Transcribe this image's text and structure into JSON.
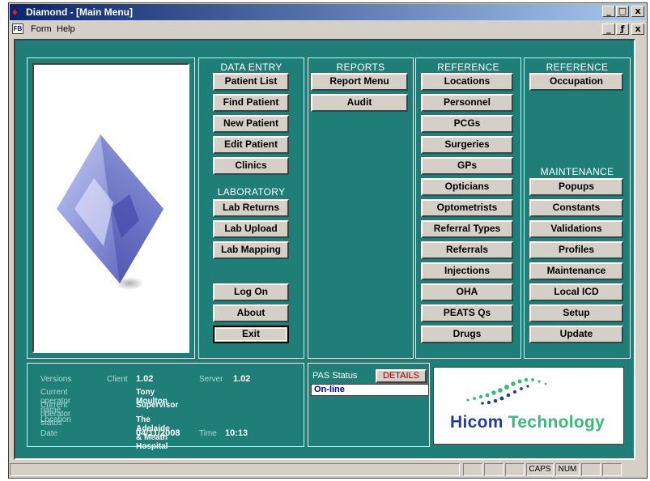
{
  "window": {
    "title": "Diamond - [Main Menu]",
    "controls": [
      "_",
      "□",
      "x"
    ],
    "mdi_controls": [
      "_",
      "ƒ",
      "x"
    ]
  },
  "menubar": {
    "items": [
      "Form",
      "Help"
    ]
  },
  "data_entry": {
    "title": "DATA ENTRY",
    "buttons": [
      "Patient  List",
      "Find Patient",
      "New Patient",
      "Edit Patient",
      "Clinics"
    ]
  },
  "laboratory": {
    "title": "LABORATORY",
    "buttons": [
      "Lab Returns",
      "Lab Upload",
      "Lab Mapping"
    ]
  },
  "session": {
    "buttons": [
      "Log On",
      "About",
      "Exit"
    ]
  },
  "reports": {
    "title": "REPORTS",
    "buttons": [
      "Report Menu",
      "Audit"
    ]
  },
  "reference1": {
    "title": "REFERENCE",
    "buttons": [
      "Locations",
      "Personnel",
      "PCGs",
      "Surgeries",
      "GPs",
      "Opticians",
      "Optometrists",
      "Referral Types",
      "Referrals",
      "Injections",
      "OHA",
      "PEATS Qs",
      "Drugs"
    ]
  },
  "reference2": {
    "title": "REFERENCE",
    "buttons": [
      "Occupation"
    ]
  },
  "maintenance": {
    "title": "MAINTENANCE",
    "buttons": [
      "Popups",
      "Constants",
      "Validations",
      "Profiles",
      "Maintenance",
      "Local ICD",
      "Setup",
      "Update"
    ]
  },
  "info": {
    "versions_label": "Versions",
    "client_label": "Client",
    "client_value": "1.02",
    "server_label": "Server",
    "server_value": "1.02",
    "operator_name_label": "Current operator name",
    "operator_name": "Tony Moulton",
    "operator_status_label": "Current operator status",
    "operator_status": "Supervisor",
    "location_label": "Location",
    "location": "The Adelaide & Meath Hospital",
    "date_label": "Date",
    "date": "04/11/2008",
    "time_label": "Time",
    "time": "10:13"
  },
  "pas": {
    "label": "PAS Status",
    "details_button": "DETAILS",
    "status": "On-line"
  },
  "logo": {
    "text_hicom": "Hicom",
    "text_tech": "Technology"
  },
  "statusbar": {
    "caps": "CAPS",
    "num": "NUM"
  },
  "colors": {
    "background": "#1f7e78",
    "title_bar": "#0a246a",
    "logo_green": "#3cb87a",
    "logo_blue": "#1e3e9e"
  }
}
